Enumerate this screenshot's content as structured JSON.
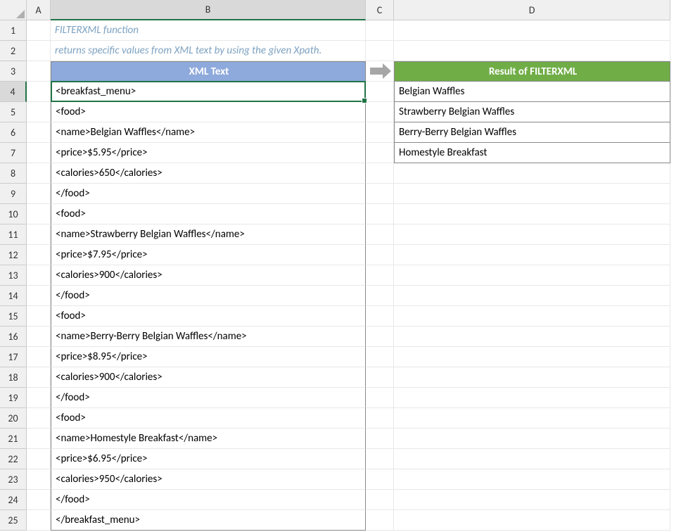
{
  "columns": [
    "A",
    "B",
    "C",
    "D"
  ],
  "row_count": 25,
  "selected_row": 4,
  "selected_col": "B",
  "title": "FILTERXML function",
  "subtitle": "returns specific values from XML text by using the given Xpath.",
  "headerXml": "XML Text",
  "headerResult": "Result of FILTERXML",
  "results": [
    "Belgian Waffles",
    "Strawberry Belgian Waffles",
    "Berry-Berry Belgian Waffles",
    "Homestyle Breakfast"
  ],
  "xml_lines": [
    "<breakfast_menu>",
    "<food>",
    "<name>Belgian Waffles</name>",
    "<price>$5.95</price>",
    "<calories>650</calories>",
    "</food>",
    "<food>",
    "<name>Strawberry Belgian Waffles</name>",
    "<price>$7.95</price>",
    "<calories>900</calories>",
    "</food>",
    "<food>",
    "<name>Berry-Berry Belgian Waffles</name>",
    "<price>$8.95</price>",
    "<calories>900</calories>",
    "</food>",
    "<food>",
    "<name>Homestyle Breakfast</name>",
    "<price>$6.95</price>",
    "<calories>950</calories>",
    "</food>",
    "</breakfast_menu>"
  ]
}
